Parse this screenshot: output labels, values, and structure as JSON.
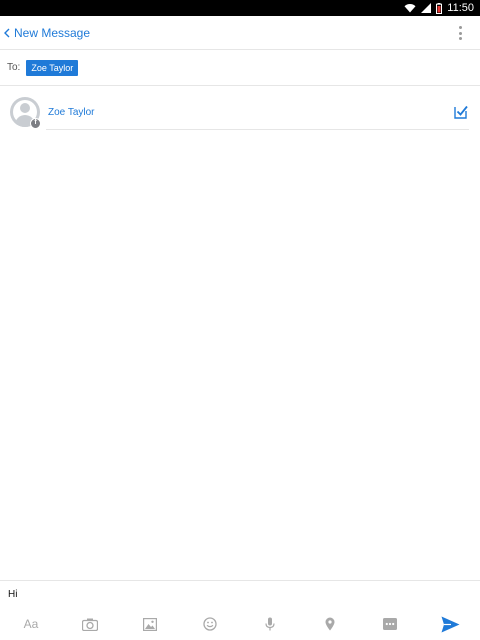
{
  "status_bar": {
    "time": "11:50"
  },
  "header": {
    "title": "New Message"
  },
  "recipients": {
    "to_label": "To:",
    "selected": [
      "Zoe Taylor"
    ]
  },
  "contacts": [
    {
      "name": "Zoe Taylor",
      "selected": true,
      "source_badge_icon": "facebook-icon"
    }
  ],
  "composer": {
    "value": "Hi"
  },
  "toolbar": {
    "text_style_label": "Aa",
    "icons": [
      "text-style",
      "camera-icon",
      "gallery-icon",
      "emoji-icon",
      "microphone-icon",
      "location-icon",
      "more-icon",
      "send-icon"
    ]
  },
  "colors": {
    "accent": "#1f7ad8",
    "icon_gray": "#a9a9a9",
    "status_bar": "#000000"
  }
}
